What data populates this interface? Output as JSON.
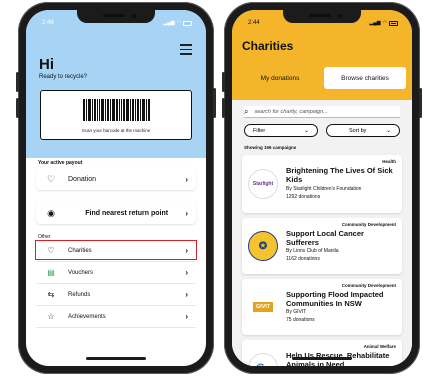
{
  "left_screen": {
    "status_time": "2:48",
    "greeting": "Hi",
    "subtitle": "Ready to recycle?",
    "barcode_caption": "Scan your barcode at the machine",
    "active_payout_label": "Your active payout",
    "payout_item": {
      "label": "Donation",
      "icon": "heart-icon"
    },
    "find_return_point": {
      "label": "Find nearest return point",
      "icon": "location-pin-icon"
    },
    "other_label": "Other",
    "other_items": [
      {
        "label": "Charities",
        "icon": "heart-icon",
        "highlighted": true
      },
      {
        "label": "Vouchers",
        "icon": "voucher-icon",
        "highlighted": false
      },
      {
        "label": "Refunds",
        "icon": "refund-icon",
        "highlighted": false
      },
      {
        "label": "Achievements",
        "icon": "star-icon",
        "highlighted": false
      }
    ],
    "highlight_color": "#d61f26",
    "top_color": "#a7d4f4"
  },
  "right_screen": {
    "status_time": "2:44",
    "title": "Charities",
    "tabs": [
      {
        "label": "My donations",
        "active": false
      },
      {
        "label": "Browse charities",
        "active": true
      }
    ],
    "search_placeholder": "search for charity, campaign...",
    "filter_label": "Filter",
    "sort_label": "Sort by",
    "showing_text": "Showing 156 campaigns",
    "campaigns": [
      {
        "category": "Health",
        "title": "Brightening The Lives Of Sick Kids",
        "by": "By Starlight Children's Foundation",
        "donations": "1292 donations",
        "logo_text": "Starlight"
      },
      {
        "category": "Community Development",
        "title": "Support Local Cancer Sufferers",
        "by": "By Lions Club of Manila",
        "donations": "1162 donations",
        "logo_text": ""
      },
      {
        "category": "Community Development",
        "title": "Supporting Flood Impacted Communities In NSW",
        "by": "By GIVIT",
        "donations": "75 donations",
        "logo_text": "GIVIT"
      },
      {
        "category": "Animal Welfare",
        "title": "Help Us Rescue, Rehabilitate Animals in Need",
        "by": "",
        "donations": "",
        "logo_text": ""
      }
    ],
    "top_color": "#f4b52b"
  }
}
